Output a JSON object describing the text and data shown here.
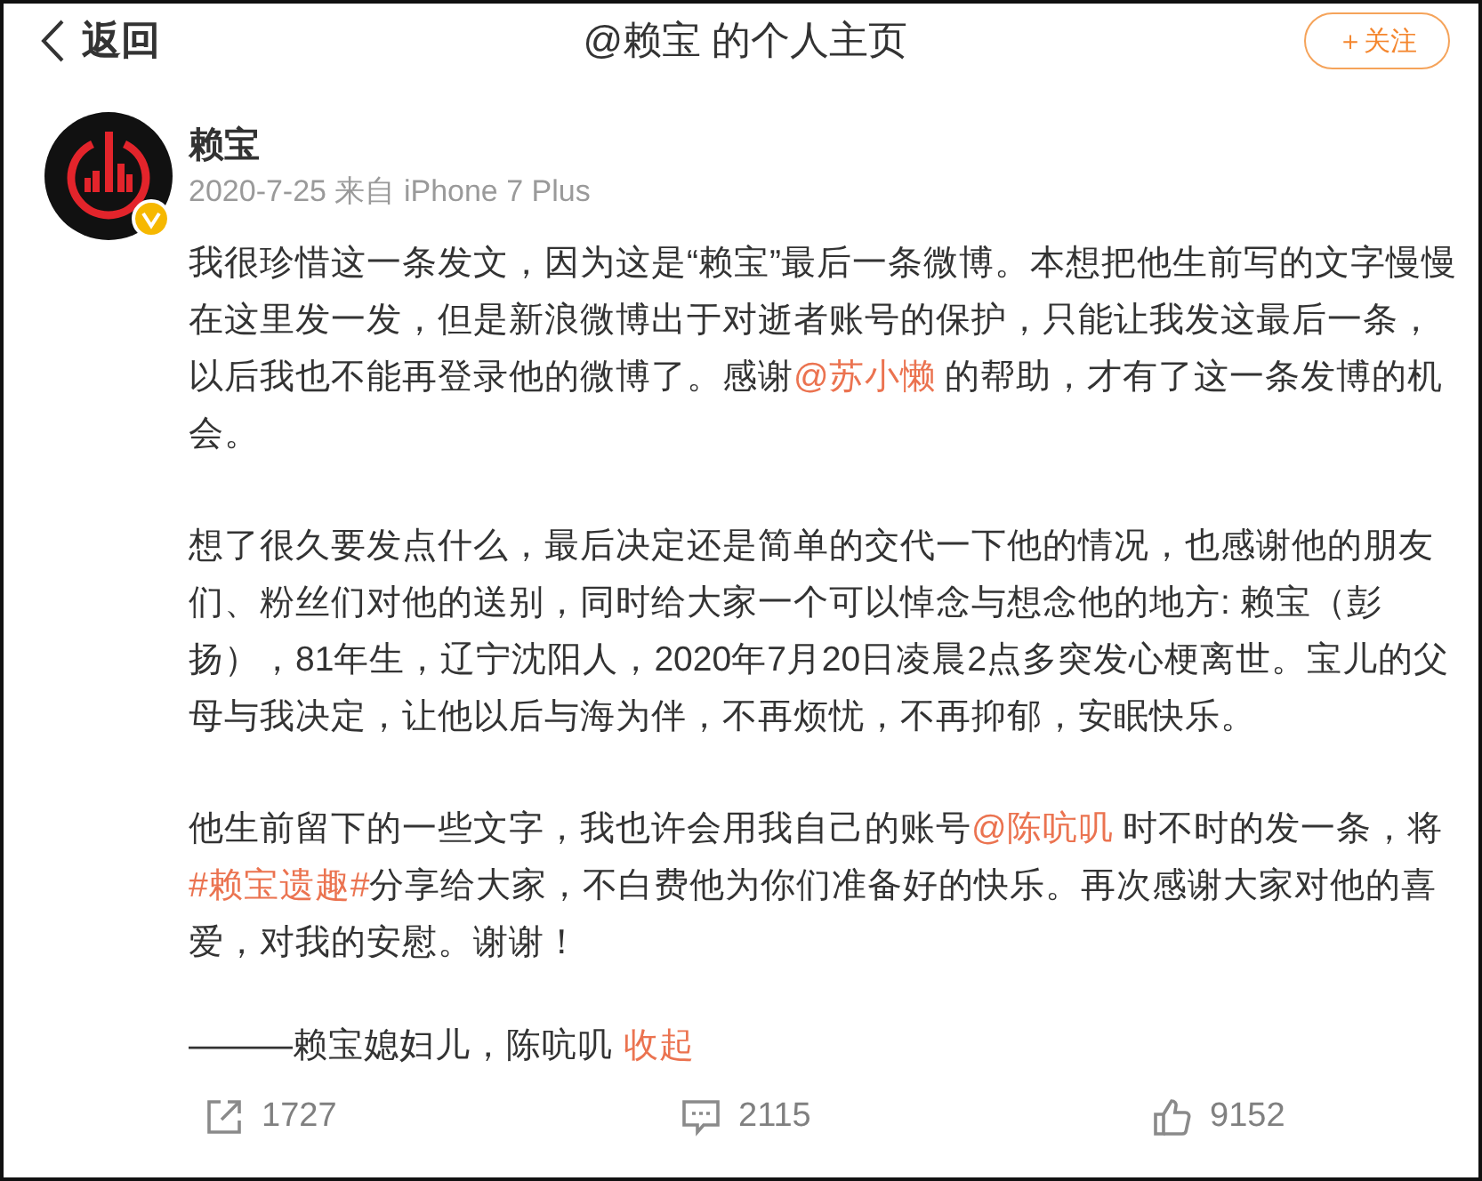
{
  "header": {
    "back_label": "返回",
    "title": "@赖宝 的个人主页",
    "follow_button": "＋关注"
  },
  "post": {
    "author": {
      "name": "赖宝",
      "verified": true
    },
    "meta": "2020-7-25 来自 iPhone 7 Plus",
    "paragraphs": [
      [
        {
          "kind": "text",
          "text": "我很珍惜这一条发文，因为这是“赖宝”最后一条微博。本想把他生前写的文字慢慢在这里发一发，但是新浪微博出于对逝者账号的保护，只能让我发这最后一条，以后我也不能再登录他的微博了。感谢"
        },
        {
          "kind": "mention",
          "text": "@苏小懒"
        },
        {
          "kind": "text",
          "text": " 的帮助，才有了这一条发博的机会。"
        }
      ],
      [
        {
          "kind": "text",
          "text": "想了很久要发点什么，最后决定还是简单的交代一下他的情况，也感谢他的朋友们、粉丝们对他的送别，同时给大家一个可以悼念与想念他的地方: 赖宝（彭扬），81年生，辽宁沈阳人，2020年7月20日凌晨2点多突发心梗离世。宝儿的父母与我决定，让他以后与海为伴，不再烦忧，不再抑郁，安眠快乐。"
        }
      ],
      [
        {
          "kind": "text",
          "text": "他生前留下的一些文字，我也许会用我自己的账号"
        },
        {
          "kind": "mention",
          "text": "@陈吭叽"
        },
        {
          "kind": "text",
          "text": " 时不时的发一条，将"
        },
        {
          "kind": "topic",
          "text": "#赖宝遗趣#"
        },
        {
          "kind": "text",
          "text": "分享给大家，不白费他为你们准备好的快乐。再次感谢大家对他的喜爱，对我的安慰。谢谢！"
        }
      ]
    ],
    "signature": [
      {
        "kind": "text",
        "text": "———赖宝媳妇儿，陈吭叽"
      },
      {
        "kind": "action",
        "text": "收起"
      }
    ],
    "actions": [
      {
        "kind": "share",
        "count": "1727"
      },
      {
        "kind": "comment",
        "count": "2115"
      },
      {
        "kind": "like",
        "count": "9152"
      }
    ]
  }
}
